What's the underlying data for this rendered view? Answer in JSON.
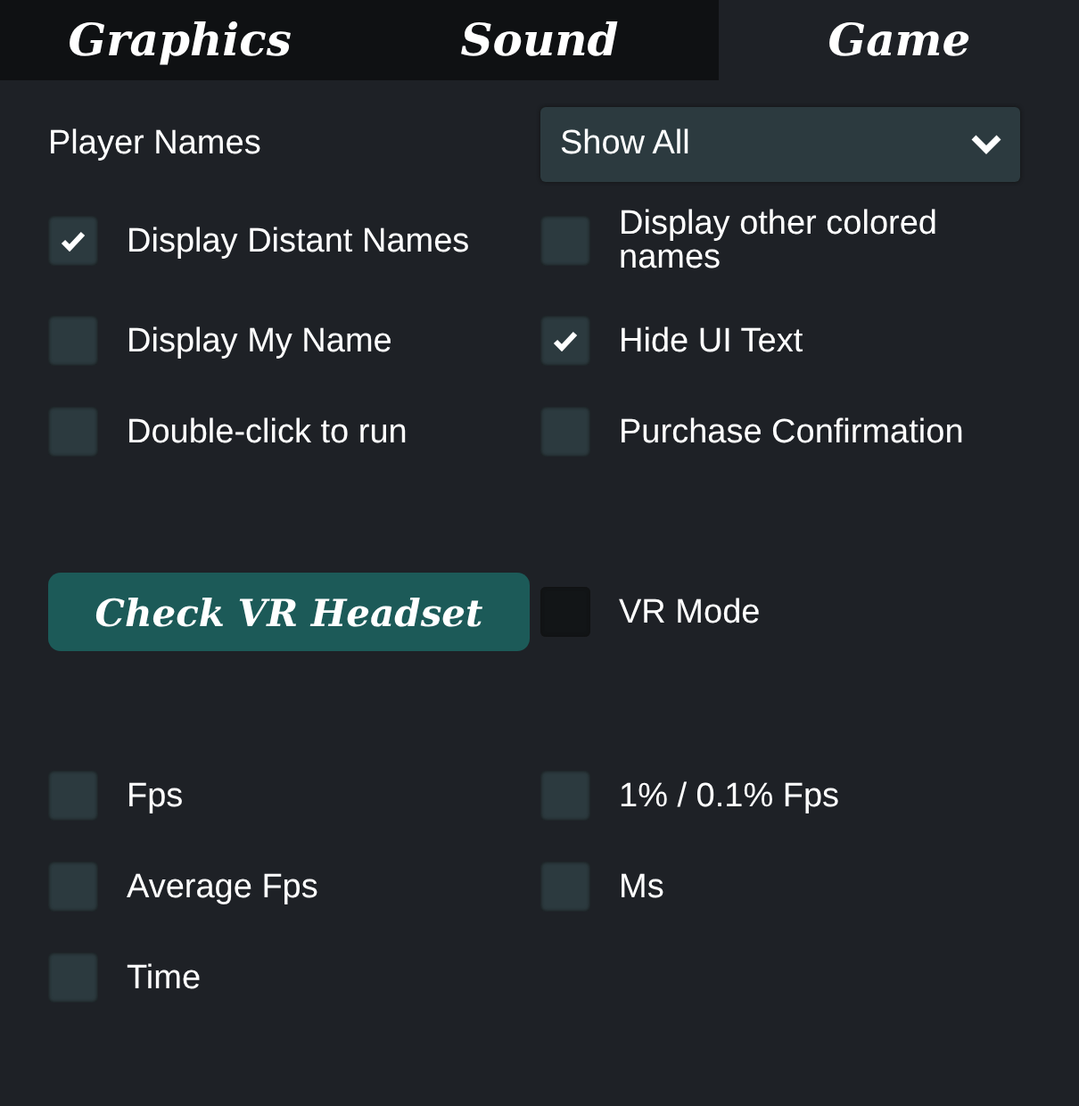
{
  "tabs": [
    {
      "label": "Graphics",
      "selected": false
    },
    {
      "label": "Sound",
      "selected": false
    },
    {
      "label": "Game",
      "selected": true
    }
  ],
  "player_names": {
    "label": "Player Names",
    "value": "Show All"
  },
  "name_options": [
    {
      "label": "Display Distant Names",
      "checked": true,
      "disabled": false
    },
    {
      "label": "Display other colored names",
      "checked": false,
      "disabled": false
    },
    {
      "label": "Display My Name",
      "checked": false,
      "disabled": false
    },
    {
      "label": "Hide UI Text",
      "checked": true,
      "disabled": false
    },
    {
      "label": "Double-click to run",
      "checked": false,
      "disabled": false
    },
    {
      "label": "Purchase Confirmation",
      "checked": false,
      "disabled": false
    }
  ],
  "vr": {
    "button": "Check VR Headset",
    "mode": {
      "label": "VR Mode",
      "checked": false,
      "disabled": true
    }
  },
  "overlay_options": [
    {
      "label": "Fps",
      "checked": false,
      "disabled": false
    },
    {
      "label": "1% / 0.1% Fps",
      "checked": false,
      "disabled": false
    },
    {
      "label": "Average Fps",
      "checked": false,
      "disabled": false
    },
    {
      "label": "Ms",
      "checked": false,
      "disabled": false
    },
    {
      "label": "Time",
      "checked": false,
      "disabled": false
    }
  ]
}
